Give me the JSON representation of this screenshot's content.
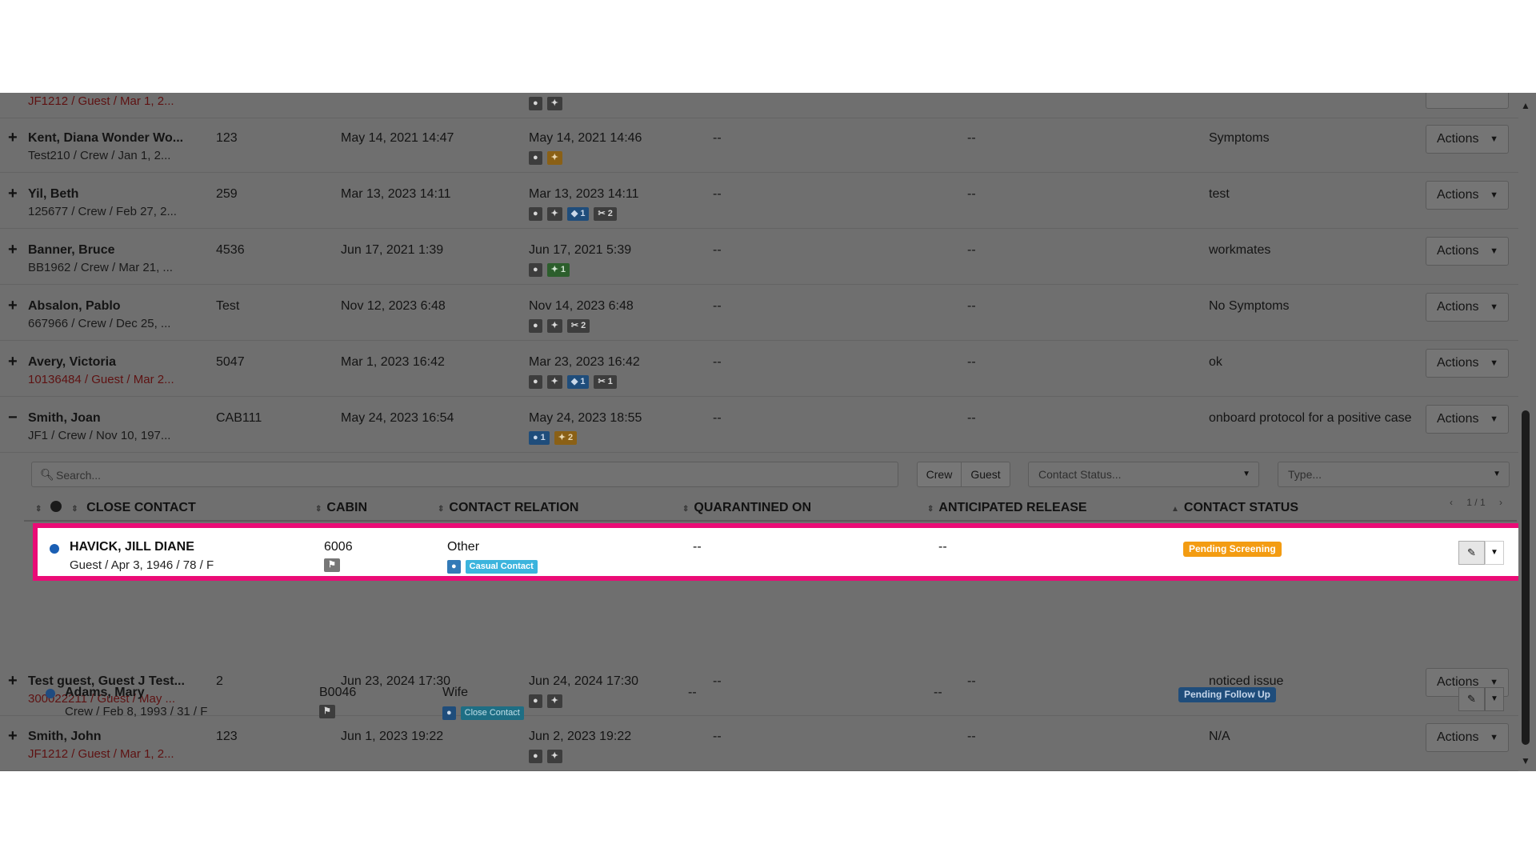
{
  "rows_top": [
    {
      "name": "",
      "sub": "JF1212 / Guest / Mar 1, 2...",
      "guest": true,
      "cabin": "",
      "added": "",
      "updated": "",
      "q": "",
      "rel": "",
      "status": "",
      "badges": [
        {
          "icon": "pin",
          "text": "",
          "color": "grey"
        },
        {
          "icon": "group",
          "text": "",
          "color": "grey"
        }
      ],
      "partial": true
    },
    {
      "name": "Kent, Diana Wonder Wo...",
      "sub": "Test210 / Crew / Jan 1, 2...",
      "guest": false,
      "cabin": "123",
      "added": "May 14, 2021 14:47",
      "updated": "May 14, 2021 14:46",
      "q": "--",
      "rel": "--",
      "status": "Symptoms",
      "badges": [
        {
          "icon": "pin",
          "text": "",
          "color": "grey"
        },
        {
          "icon": "group",
          "text": "",
          "color": "orange"
        }
      ]
    },
    {
      "name": "Yil, Beth",
      "sub": "125677 / Crew / Feb 27, 2...",
      "guest": false,
      "cabin": "259",
      "added": "Mar 13, 2023 14:11",
      "updated": "Mar 13, 2023 14:11",
      "q": "--",
      "rel": "--",
      "status": "test",
      "badges": [
        {
          "icon": "pin",
          "text": "",
          "color": "grey"
        },
        {
          "icon": "group",
          "text": "",
          "color": "grey"
        },
        {
          "icon": "tag",
          "text": "1",
          "color": "blue"
        },
        {
          "icon": "clip",
          "text": "2",
          "color": "grey"
        }
      ]
    },
    {
      "name": "Banner, Bruce",
      "sub": "BB1962 / Crew / Mar 21, ...",
      "guest": false,
      "cabin": "4536",
      "added": "Jun 17, 2021 1:39",
      "updated": "Jun 17, 2021 5:39",
      "q": "--",
      "rel": "--",
      "status": "workmates",
      "badges": [
        {
          "icon": "pin",
          "text": "",
          "color": "grey"
        },
        {
          "icon": "group",
          "text": "1",
          "color": "green"
        }
      ]
    },
    {
      "name": "Absalon, Pablo",
      "sub": "667966 / Crew / Dec 25, ...",
      "guest": false,
      "cabin": "Test",
      "added": "Nov 12, 2023 6:48",
      "updated": "Nov 14, 2023 6:48",
      "q": "--",
      "rel": "--",
      "status": "No Symptoms",
      "badges": [
        {
          "icon": "pin",
          "text": "",
          "color": "grey"
        },
        {
          "icon": "group",
          "text": "",
          "color": "grey"
        },
        {
          "icon": "clip",
          "text": "2",
          "color": "grey"
        }
      ]
    },
    {
      "name": "Avery, Victoria",
      "sub": "10136484 / Guest / Mar 2...",
      "guest": true,
      "cabin": "5047",
      "added": "Mar 1, 2023 16:42",
      "updated": "Mar 23, 2023 16:42",
      "q": "--",
      "rel": "--",
      "status": "ok",
      "badges": [
        {
          "icon": "pin",
          "text": "",
          "color": "grey"
        },
        {
          "icon": "group",
          "text": "",
          "color": "grey"
        },
        {
          "icon": "tag",
          "text": "1",
          "color": "blue"
        },
        {
          "icon": "clip",
          "text": "1",
          "color": "grey"
        }
      ]
    },
    {
      "name": "Smith, Joan",
      "sub": "JF1 / Crew / Nov 10, 197...",
      "guest": false,
      "cabin": "CAB111",
      "added": "May 24, 2023 16:54",
      "updated": "May 24, 2023 18:55",
      "q": "--",
      "rel": "--",
      "status": "onboard protocol for a positive case",
      "badges": [
        {
          "icon": "pin",
          "text": "1",
          "color": "blue"
        },
        {
          "icon": "group",
          "text": "2",
          "color": "orange"
        }
      ],
      "expanded": true
    }
  ],
  "actions_label": "Actions",
  "subpanel": {
    "search_placeholder": "Search...",
    "crew_label": "Crew",
    "guest_label": "Guest",
    "status_placeholder": "Contact Status...",
    "type_placeholder": "Type...",
    "headers": {
      "close_contact": "CLOSE CONTACT",
      "cabin": "CABIN",
      "relation": "CONTACT RELATION",
      "quarantined": "QUARANTINED ON",
      "release": "ANTICIPATED RELEASE",
      "status": "CONTACT STATUS"
    },
    "pager": "1 / 1",
    "contacts": [
      {
        "name": "HAVICK, JILL DIANE",
        "sub": "Guest / Apr 3, 1946 / 78 / F",
        "cabin": "6006",
        "relation": "Other",
        "relation_tag": "Casual Contact",
        "quarantined": "--",
        "release": "--",
        "status": "Pending Screening",
        "status_color": "#f39c12"
      },
      {
        "name": "Adams, Mary",
        "sub": "Crew / Feb 8, 1993 / 31 / F",
        "cabin": "B0046",
        "relation": "Wife",
        "relation_tag": "Close Contact",
        "quarantined": "--",
        "release": "--",
        "status": "Pending Follow Up",
        "status_color": "#1f4d7b"
      }
    ]
  },
  "rows_bottom": [
    {
      "name": "Test guest, Guest J Test...",
      "sub": "300022211 / Guest / May ...",
      "guest": true,
      "cabin": "2",
      "added": "Jun 23, 2024 17:30",
      "updated": "Jun 24, 2024 17:30",
      "q": "--",
      "rel": "--",
      "status": "noticed issue",
      "badges": [
        {
          "icon": "pin",
          "text": "",
          "color": "grey"
        },
        {
          "icon": "group",
          "text": "",
          "color": "grey"
        }
      ]
    },
    {
      "name": "Smith, John",
      "sub": "JF1212 / Guest / Mar 1, 2...",
      "guest": true,
      "cabin": "123",
      "added": "Jun 1, 2023 19:22",
      "updated": "Jun 2, 2023 19:22",
      "q": "--",
      "rel": "--",
      "status": "N/A",
      "badges": [
        {
          "icon": "pin",
          "text": "",
          "color": "grey"
        },
        {
          "icon": "group",
          "text": "",
          "color": "grey"
        }
      ]
    }
  ],
  "colors": {
    "highlight": "#ea0c76",
    "overlay": "#6f6f6f"
  }
}
